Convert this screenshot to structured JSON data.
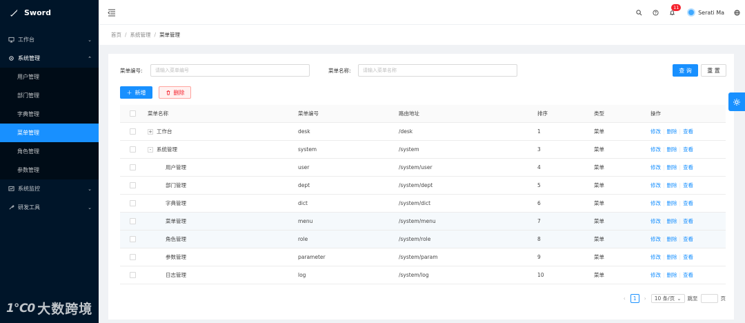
{
  "app": {
    "name": "Sword"
  },
  "sidebar": {
    "menus": [
      {
        "label": "工作台",
        "icon": "monitor-icon",
        "arrow": "⌄"
      },
      {
        "label": "系统管理",
        "icon": "gear-icon",
        "arrow": "⌃",
        "children": [
          "用户管理",
          "部门管理",
          "字典管理",
          "菜单管理",
          "角色管理",
          "参数管理"
        ],
        "active_child": "菜单管理"
      },
      {
        "label": "系统监控",
        "icon": "monitor-chart-icon",
        "arrow": "⌄"
      },
      {
        "label": "研发工具",
        "icon": "tool-icon",
        "arrow": "⌄"
      }
    ],
    "watermark": "大数跨境",
    "watermark_logo": "1℃0"
  },
  "header": {
    "notification_count": "11",
    "user_name": "Serati Ma"
  },
  "breadcrumb": [
    "首页",
    "系统管理",
    "菜单管理"
  ],
  "search": {
    "code_label": "菜单编号:",
    "code_placeholder": "请输入菜单编号",
    "name_label": "菜单名称:",
    "name_placeholder": "请输入菜单名称",
    "query_label": "查 询",
    "reset_label": "重 置"
  },
  "toolbar": {
    "add_label": "新增",
    "delete_label": "删除"
  },
  "table": {
    "columns": [
      "菜单名称",
      "菜单编号",
      "路由地址",
      "排序",
      "类型",
      "操作"
    ],
    "actions": [
      "修改",
      "删除",
      "查看"
    ],
    "rows": [
      {
        "name": "工作台",
        "code": "desk",
        "path": "/desk",
        "sort": "1",
        "type": "菜单",
        "expand": "+",
        "level": 0
      },
      {
        "name": "系统管理",
        "code": "system",
        "path": "/system",
        "sort": "3",
        "type": "菜单",
        "expand": "-",
        "level": 0
      },
      {
        "name": "用户管理",
        "code": "user",
        "path": "/system/user",
        "sort": "4",
        "type": "菜单",
        "expand": "",
        "level": 1
      },
      {
        "name": "部门管理",
        "code": "dept",
        "path": "/system/dept",
        "sort": "5",
        "type": "菜单",
        "expand": "",
        "level": 1
      },
      {
        "name": "字典管理",
        "code": "dict",
        "path": "/system/dict",
        "sort": "6",
        "type": "菜单",
        "expand": "",
        "level": 1
      },
      {
        "name": "菜单管理",
        "code": "menu",
        "path": "/system/menu",
        "sort": "7",
        "type": "菜单",
        "expand": "",
        "level": 1
      },
      {
        "name": "角色管理",
        "code": "role",
        "path": "/system/role",
        "sort": "8",
        "type": "菜单",
        "expand": "",
        "level": 1
      },
      {
        "name": "参数管理",
        "code": "parameter",
        "path": "/system/param",
        "sort": "9",
        "type": "菜单",
        "expand": "",
        "level": 1
      },
      {
        "name": "日志管理",
        "code": "log",
        "path": "/system/log",
        "sort": "10",
        "type": "菜单",
        "expand": "",
        "level": 1
      }
    ]
  },
  "pagination": {
    "current": "1",
    "page_size": "10 条/页",
    "jump_label": "跳至",
    "page_suffix": "页"
  },
  "colors": {
    "primary": "#1890ff",
    "sidebar": "#001529",
    "danger": "#f5222d"
  }
}
